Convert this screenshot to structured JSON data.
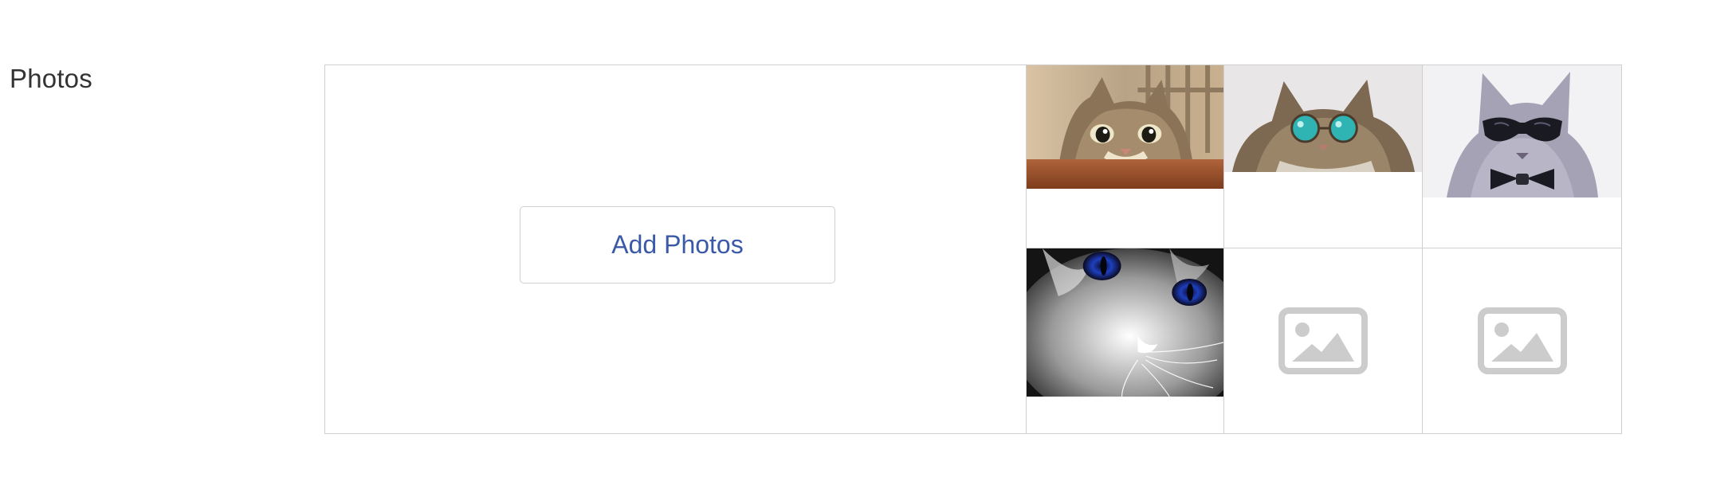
{
  "section": {
    "label": "Photos"
  },
  "add_photos": {
    "label": "Add Photos"
  },
  "photos": [
    {
      "name": "cat-peeking-over-table-photo",
      "kind": "image"
    },
    {
      "name": "cat-with-teal-glasses-photo",
      "kind": "image"
    },
    {
      "name": "grey-cat-sunglasses-bowtie-photo",
      "kind": "image"
    },
    {
      "name": "glowing-blue-eyed-cat-photo",
      "kind": "image"
    },
    {
      "name": "empty-photo-slot",
      "kind": "placeholder",
      "icon": "image-placeholder-icon"
    },
    {
      "name": "empty-photo-slot",
      "kind": "placeholder",
      "icon": "image-placeholder-icon"
    }
  ],
  "colors": {
    "border": "#cfcfcf",
    "button_text": "#3a5aa8",
    "label_text": "#333333",
    "placeholder_icon": "#cccccc"
  }
}
